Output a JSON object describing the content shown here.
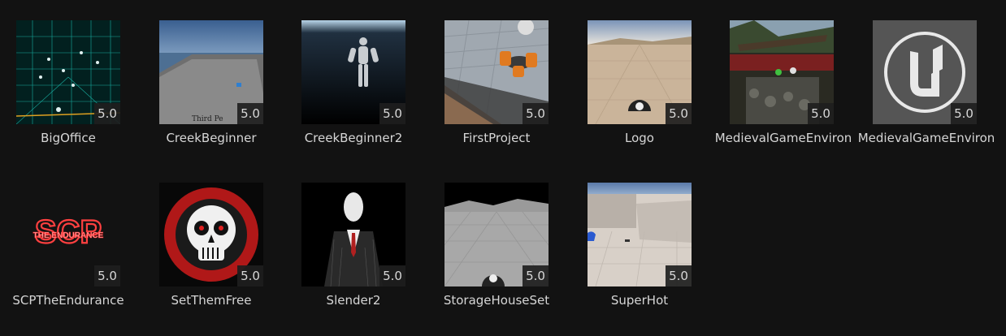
{
  "projects": [
    {
      "name": "BigOffice",
      "version": "5.0",
      "thumb": "bigoffice-thumbnail"
    },
    {
      "name": "CreekBeginner",
      "version": "5.0",
      "thumb": "creekbeginner-thumbnail"
    },
    {
      "name": "CreekBeginner2",
      "version": "5.0",
      "thumb": "creekbeginner2-thumbnail"
    },
    {
      "name": "FirstProject",
      "version": "5.0",
      "thumb": "firstproject-thumbnail"
    },
    {
      "name": "Logo",
      "version": "5.0",
      "thumb": "logo-thumbnail"
    },
    {
      "name": "MedievalGameEnviron",
      "version": "5.0",
      "thumb": "medieval-thumbnail"
    },
    {
      "name": "MedievalGameEnviron",
      "version": "5.0",
      "thumb": "unreal-logo-thumbnail"
    },
    {
      "name": "SCPTheEndurance",
      "version": "5.0",
      "thumb": "scp-thumbnail"
    },
    {
      "name": "SetThemFree",
      "version": "5.0",
      "thumb": "skull-thumbnail"
    },
    {
      "name": "Slender2",
      "version": "5.0",
      "thumb": "slender-thumbnail"
    },
    {
      "name": "StorageHouseSet",
      "version": "5.0",
      "thumb": "storagehouse-thumbnail"
    },
    {
      "name": "SuperHot",
      "version": "5.0",
      "thumb": "superhot-thumbnail"
    }
  ],
  "scp_thumb": {
    "big_text": "SCP",
    "sub_text": "THE ENDURANCE"
  },
  "colors": {
    "background": "#121212",
    "label": "#d6d6d6",
    "version_badge": "#1e1e1e"
  }
}
